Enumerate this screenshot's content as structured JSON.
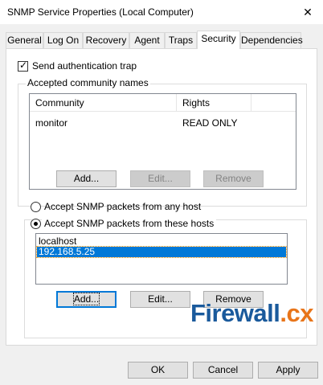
{
  "window": {
    "title": "SNMP Service Properties (Local Computer)",
    "close_glyph": "✕"
  },
  "tabs": [
    {
      "label": "General",
      "active": false
    },
    {
      "label": "Log On",
      "active": false
    },
    {
      "label": "Recovery",
      "active": false
    },
    {
      "label": "Agent",
      "active": false
    },
    {
      "label": "Traps",
      "active": false
    },
    {
      "label": "Security",
      "active": true
    },
    {
      "label": "Dependencies",
      "active": false
    }
  ],
  "security": {
    "send_auth_trap": {
      "label": "Send authentication trap",
      "checked": true
    },
    "community_group": {
      "title": "Accepted community names",
      "columns": [
        "Community",
        "Rights"
      ],
      "rows": [
        {
          "community": "monitor",
          "rights": "READ ONLY"
        }
      ],
      "buttons": {
        "add": "Add...",
        "edit": "Edit...",
        "remove": "Remove"
      }
    },
    "accept_any_host": {
      "label": "Accept SNMP packets from any host",
      "selected": false
    },
    "accept_these_hosts": {
      "label": "Accept SNMP packets from these hosts",
      "selected": true
    },
    "hosts": [
      {
        "name": "localhost",
        "selected": false
      },
      {
        "name": "192.168.5.25",
        "selected": true
      }
    ],
    "host_buttons": {
      "add": "Add...",
      "edit": "Edit...",
      "remove": "Remove"
    }
  },
  "watermark": {
    "main": "Firewall",
    "suffix": ".cx"
  },
  "footer": {
    "ok": "OK",
    "cancel": "Cancel",
    "apply": "Apply"
  },
  "colors": {
    "selection": "#0078d7",
    "watermark_blue": "#1a5a9c",
    "watermark_orange": "#e8751a"
  }
}
